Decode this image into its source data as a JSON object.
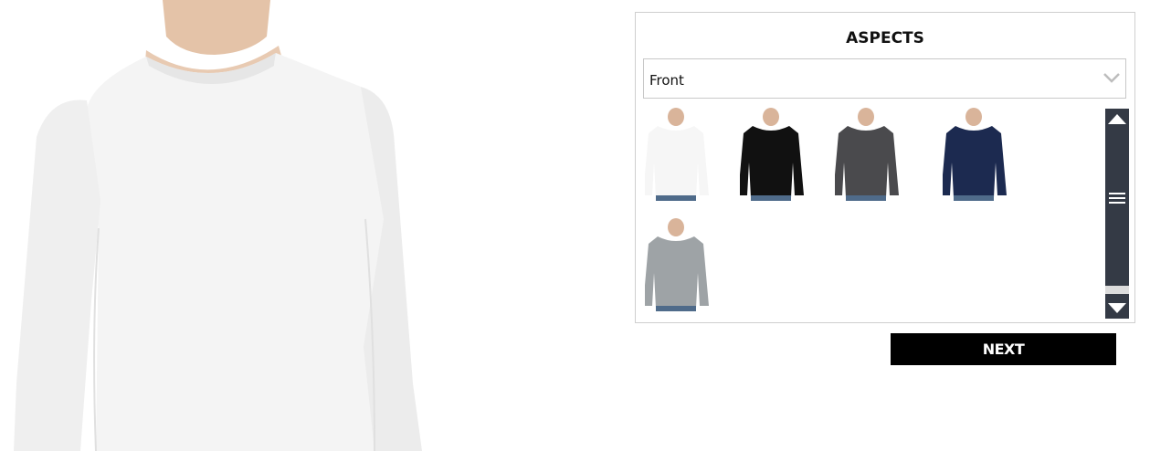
{
  "aspects": {
    "title": "ASPECTS",
    "selected": "Front",
    "thumbnails": [
      {
        "name": "white",
        "color": "#f6f6f6"
      },
      {
        "name": "black",
        "color": "#111111"
      },
      {
        "name": "dark-grey",
        "color": "#4a4a4d"
      },
      {
        "name": "navy",
        "color": "#1c2a50"
      },
      {
        "name": "heather-grey",
        "color": "#9ea3a6"
      }
    ]
  },
  "next_label": "NEXT",
  "icons": {
    "dropdown": "chevron-down-icon",
    "scroll_up": "triangle-up-icon",
    "scroll_grip": "hamburger-icon",
    "scroll_down": "triangle-down-icon"
  }
}
